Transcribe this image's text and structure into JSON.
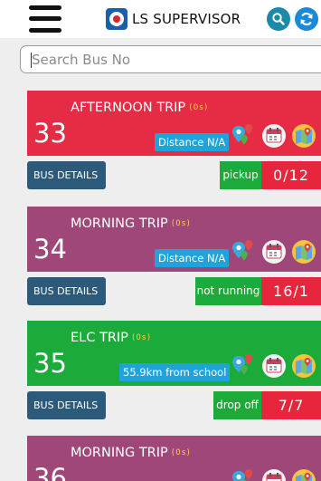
{
  "header": {
    "title": "LS SUPERVISOR",
    "icons": {
      "menu": "hamburger-icon",
      "logo": "school-logo",
      "search": "search-icon",
      "refresh": "refresh-icon"
    }
  },
  "search": {
    "placeholder": "Search Bus No",
    "value": ""
  },
  "colors": {
    "red": "#e52c44",
    "purple": "#a0477a",
    "green": "#1caa3a",
    "details": "#2c5a7a",
    "distance": "#1fa3dc",
    "duration": "#ffd24a",
    "count": "#e7263d"
  },
  "buses": [
    {
      "bus_no": "33",
      "trip": "AFTERNOON TRIP",
      "duration": "(0s)",
      "distance": "Distance N/A",
      "details_label": "BUS DETAILS",
      "status": "pickup",
      "count": "0/12",
      "color": "red"
    },
    {
      "bus_no": "34",
      "trip": "MORNING TRIP",
      "duration": "(0s)",
      "distance": "Distance N/A",
      "details_label": "BUS DETAILS",
      "status": "not running",
      "count": "16/1",
      "color": "purple"
    },
    {
      "bus_no": "35",
      "trip": "ELC TRIP",
      "duration": "(0s)",
      "distance": "55.9km from school",
      "details_label": "BUS DETAILS",
      "status": "drop off",
      "count": "7/7",
      "color": "green"
    },
    {
      "bus_no": "36",
      "trip": "MORNING TRIP",
      "duration": "(0s)",
      "distance": "",
      "details_label": "",
      "status": "",
      "count": "",
      "color": "purple"
    }
  ]
}
